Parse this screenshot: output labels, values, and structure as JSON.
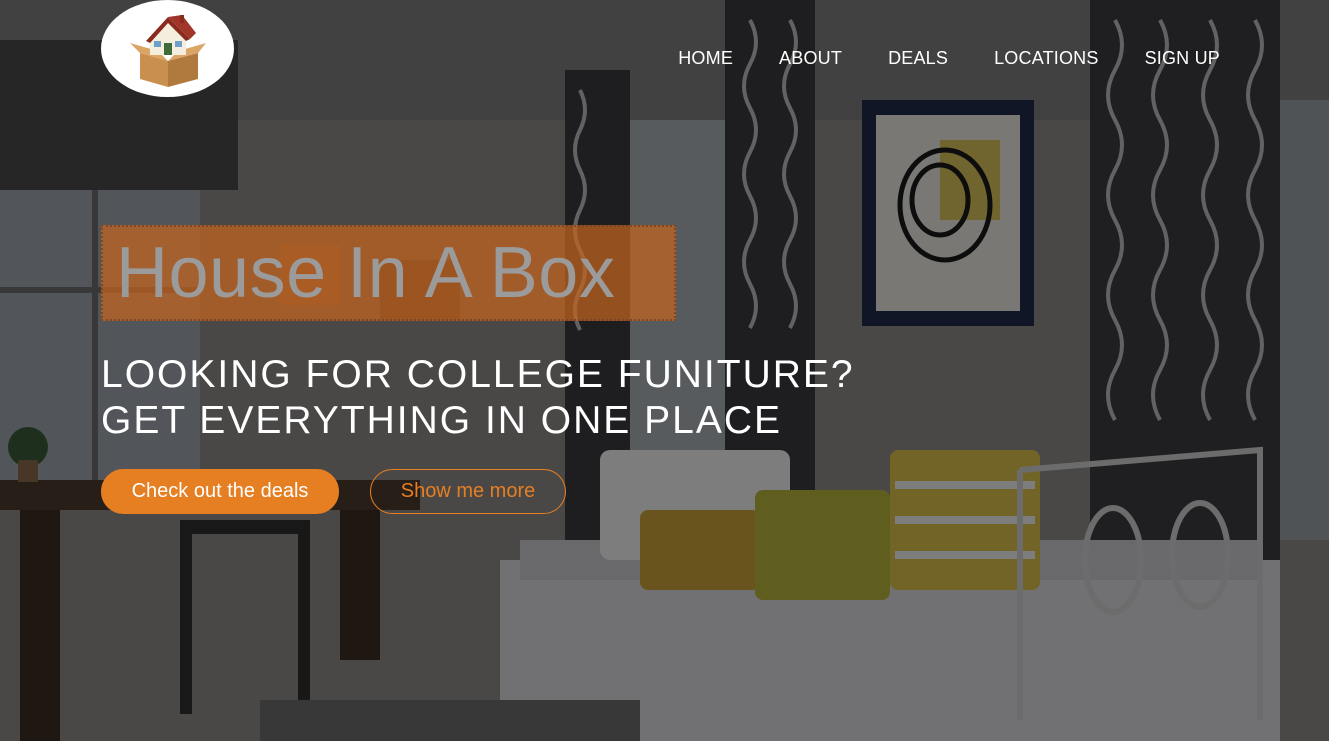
{
  "header": {
    "logo_icon": "house-in-box-icon",
    "nav": [
      {
        "label": "HOME"
      },
      {
        "label": "ABOUT"
      },
      {
        "label": "DEALS"
      },
      {
        "label": "LOCATIONS"
      },
      {
        "label": "SIGN UP"
      }
    ]
  },
  "hero": {
    "brand_title": "House In A Box",
    "tagline_line1": "LOOKING FOR COLLEGE FUNITURE?",
    "tagline_line2": "GET EVERYTHING IN ONE PLACE",
    "primary_button": "Check out the deals",
    "secondary_button": "Show me more"
  },
  "colors": {
    "accent": "#e67e22",
    "text": "#ffffff",
    "brand_title": "#9b9b9b"
  }
}
